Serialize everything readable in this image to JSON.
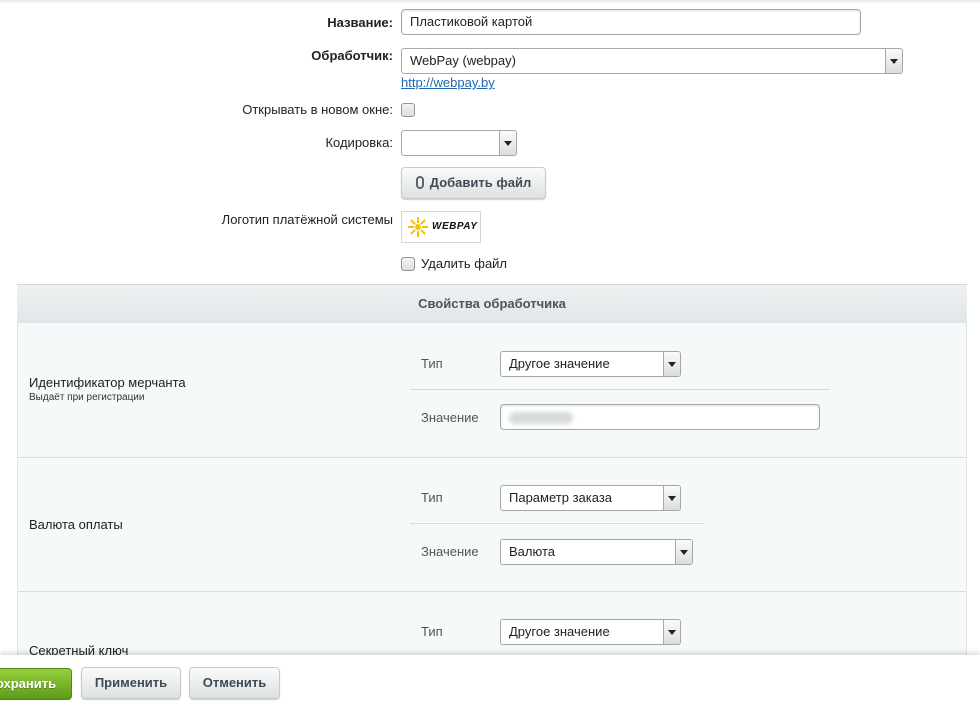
{
  "form": {
    "name_label": "Название:",
    "name_value": "Пластиковой картой",
    "handler_label": "Обработчик:",
    "handler_value": "WebPay (webpay)",
    "handler_link": "http://webpay.by",
    "new_window_label": "Открывать в новом окне:",
    "new_window_checked": false,
    "encoding_label": "Кодировка:",
    "encoding_value": "",
    "add_file_button": "Добавить файл",
    "logo_label": "Логотип платёжной системы",
    "logo_text": "WEBPAY",
    "delete_file_label": "Удалить файл",
    "delete_file_checked": false
  },
  "properties": {
    "header": "Свойства обработчика",
    "sections": [
      {
        "title": "Идентификатор мерчанта",
        "hint": "Выдаёт при регистрации",
        "type_label": "Тип",
        "type_value": "Другое значение",
        "value_label": "Значение",
        "value_value": "",
        "value_redacted": true
      },
      {
        "title": "Валюта оплаты",
        "type_label": "Тип",
        "type_value": "Параметр заказа",
        "value_label": "Значение",
        "value_value": "Валюта"
      },
      {
        "title": "Секретный ключ",
        "type_label": "Тип",
        "type_value": "Другое значение"
      }
    ]
  },
  "footer": {
    "save_button": "охранить",
    "apply_button": "Применить",
    "cancel_button": "Отменить"
  },
  "colors": {
    "link": "#2067b0",
    "save_button": "#7ab52c",
    "panel_background": "#f5f9f9"
  }
}
